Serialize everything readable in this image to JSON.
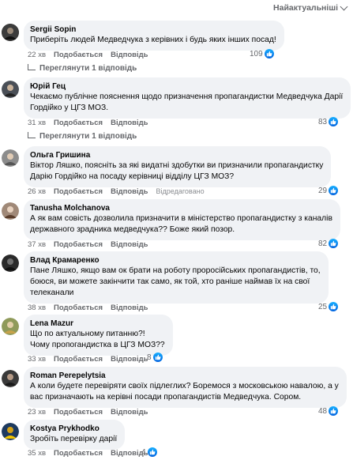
{
  "sort": {
    "label": "Найактуальніші"
  },
  "actions": {
    "like": "Подобається",
    "reply": "Відповідь"
  },
  "comments": [
    {
      "author": "Sergii Sopin",
      "text": "Приберіть людей Медведчука з керівних і будь яких інших посад!",
      "time": "22 хв",
      "likes": "109",
      "replies": "Переглянути 1 відповідь",
      "avatar_color": "#2d2d2d"
    },
    {
      "author": "Юрій Гец",
      "text": "Чекаємо публічне пояснення щодо призначення пропагандистки Медведчука Дарії\nГордійко у ЦГЗ МОЗ.",
      "time": "31 хв",
      "likes": "83",
      "replies": "Переглянути 1 відповідь",
      "avatar_color": "#3a3f47"
    },
    {
      "author": "Ольга Гришина",
      "text": "Віктор Ляшко, поясніть за які видатні здобутки ви призначили пропагандистку\nДарію Гордійко на посаду керівниці відділу ЦГЗ МОЗ?",
      "time": "26 хв",
      "likes": "29",
      "edited": "Відредаговано",
      "avatar_color": "#6b6b6b"
    },
    {
      "author": "Tanusha Molchanova",
      "text": "А як вам совість дозволила призначити в міністерство пропагандистку з каналів\nдержавного зрадника медведчука?? Боже який позор.",
      "time": "37 хв",
      "likes": "82",
      "avatar_color": "#8a6f5c"
    },
    {
      "author": "Влад Крамаренко",
      "text": "Пане Ляшко, якщо вам ок брати на роботу проросійських пропагандистів, то,\nбоюся, ви можете закінчити так само, як той, хто раніше наймав їх на свої\nтелеканали",
      "time": "38 хв",
      "likes": "25",
      "avatar_color": "#1f1f1f"
    },
    {
      "author": "Lena Mazur",
      "text": "Що по актуальному питанню?!\nЧому пропогандистка в ЦГЗ МОЗ??",
      "time": "33 хв",
      "likes": "8",
      "avatar_color": "#7a8a4a"
    },
    {
      "author": "Roman Perepelytsia",
      "text": "А коли будете перевіряти своїх підлеглих? Боремося з московською навалою, а у\nвас призначають на керівні посади пропагандистів Медведчука. Сором.",
      "time": "23 хв",
      "likes": "48",
      "avatar_color": "#2b2b2b"
    },
    {
      "author": "Kostya Prykhodko",
      "text": "Зробіть перевірку дарії",
      "time": "35 хв",
      "likes": "4",
      "avatar_color": "#d4a017"
    }
  ]
}
